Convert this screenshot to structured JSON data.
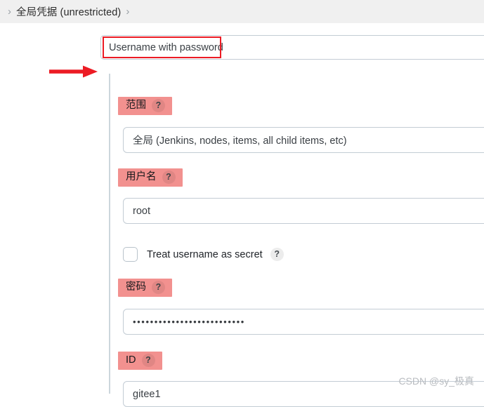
{
  "breadcrumb": {
    "leading_chevron": "›",
    "item_label": "全局凭据 (unrestricted)",
    "trailing_chevron": "›"
  },
  "credential_type": {
    "label": "Username with password",
    "annotation_color": "#ec1b24"
  },
  "form": {
    "scope": {
      "label": "范围",
      "help": "?",
      "value": "全局 (Jenkins, nodes, items, all child items, etc)"
    },
    "username": {
      "label": "用户名",
      "help": "?",
      "value": "root"
    },
    "treat_username_as_secret": {
      "label": "Treat username as secret",
      "help": "?",
      "checked": false
    },
    "password": {
      "label": "密码",
      "help": "?",
      "value": "••••••••••••••••••••••••••"
    },
    "id": {
      "label": "ID",
      "help": "?",
      "value": "gitee1"
    }
  },
  "watermark": {
    "text": "CSDN @sy_极真"
  },
  "colors": {
    "label_highlight": "#f2918f",
    "annotation_red": "#ec1b24",
    "panel_border": "#ccd6dc",
    "input_border": "#c3ccd4",
    "header_bg": "#f0f0f0"
  }
}
